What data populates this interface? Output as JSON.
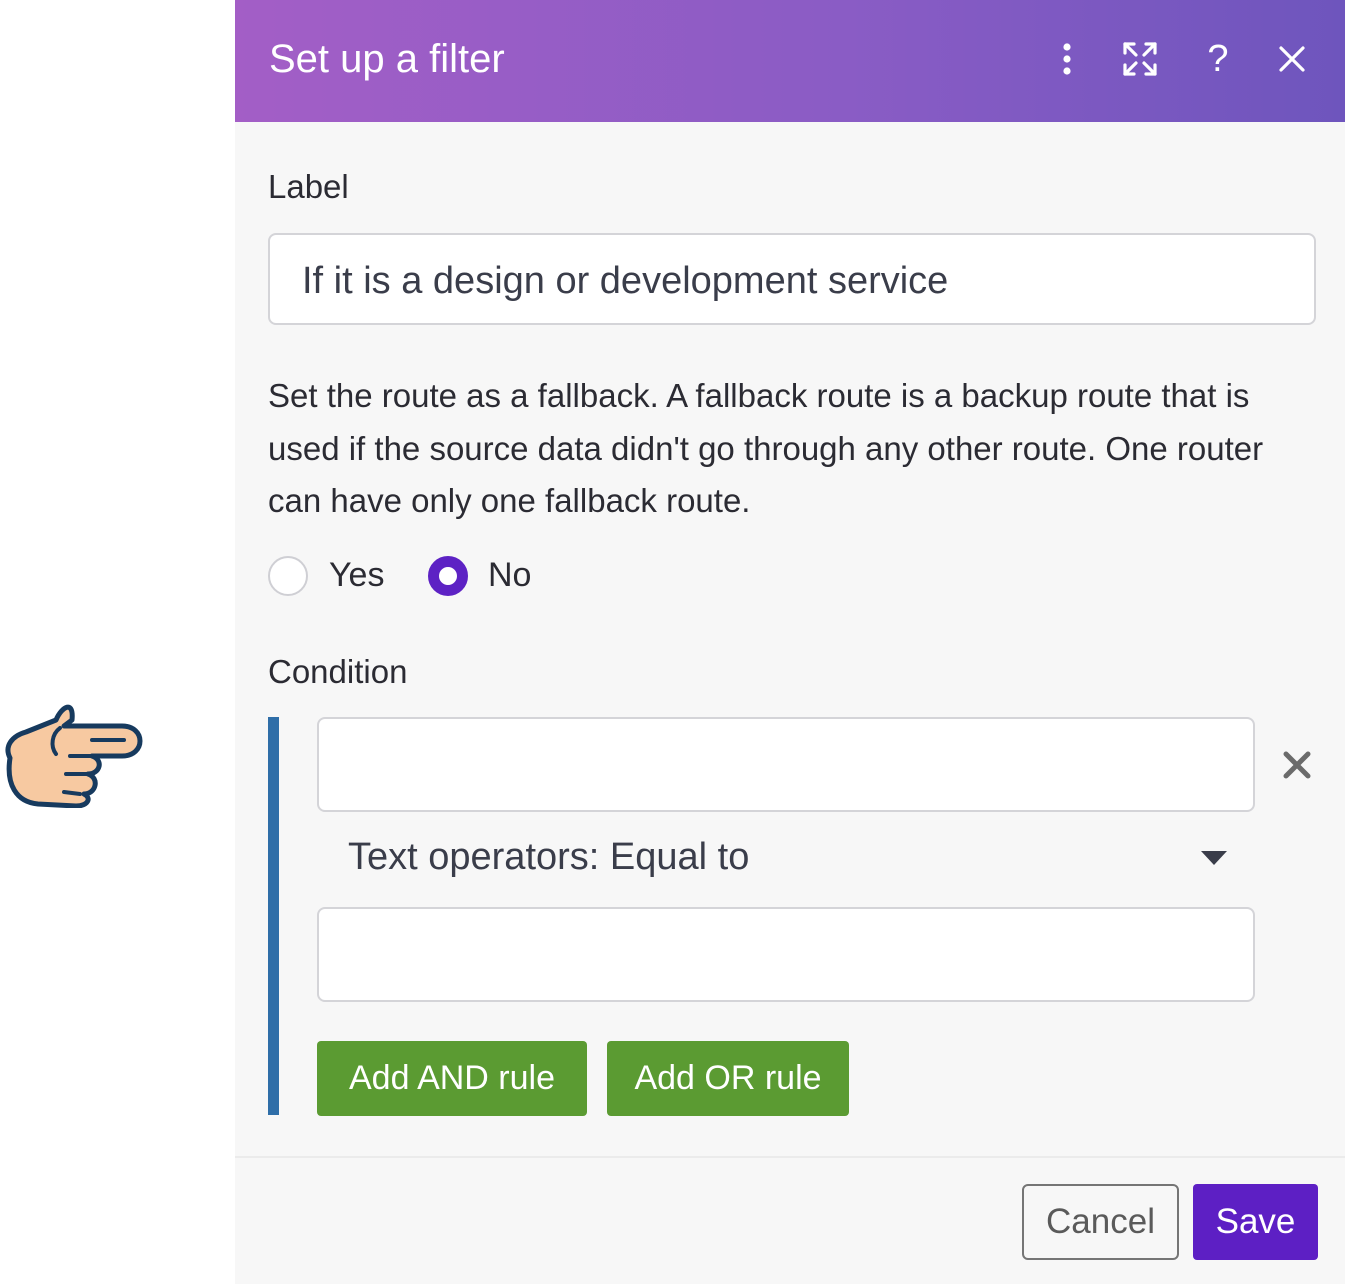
{
  "dialog": {
    "title": "Set up a filter",
    "icons": [
      "more-vertical-icon",
      "expand-icon",
      "help-icon",
      "close-icon"
    ],
    "help_glyph": "?"
  },
  "label_section": {
    "label": "Label",
    "value": "If it is a design or development service"
  },
  "fallback": {
    "description": "Set the route as a fallback. A fallback route is a backup route that is used if the source data didn't go through any other route. One router can have only one fallback route.",
    "options": [
      {
        "label": "Yes",
        "selected": false
      },
      {
        "label": "No",
        "selected": true
      }
    ]
  },
  "condition": {
    "label": "Condition",
    "first_operand": "",
    "operator": "Text operators: Equal to",
    "second_operand": "",
    "add_and_label": "Add AND rule",
    "add_or_label": "Add OR rule"
  },
  "footer": {
    "cancel_label": "Cancel",
    "save_label": "Save"
  },
  "colors": {
    "header_start": "#a35ec6",
    "header_end": "#6e55bd",
    "accent": "#5d22c4",
    "green": "#5b9b32",
    "condition_bar": "#2f6ea8"
  }
}
